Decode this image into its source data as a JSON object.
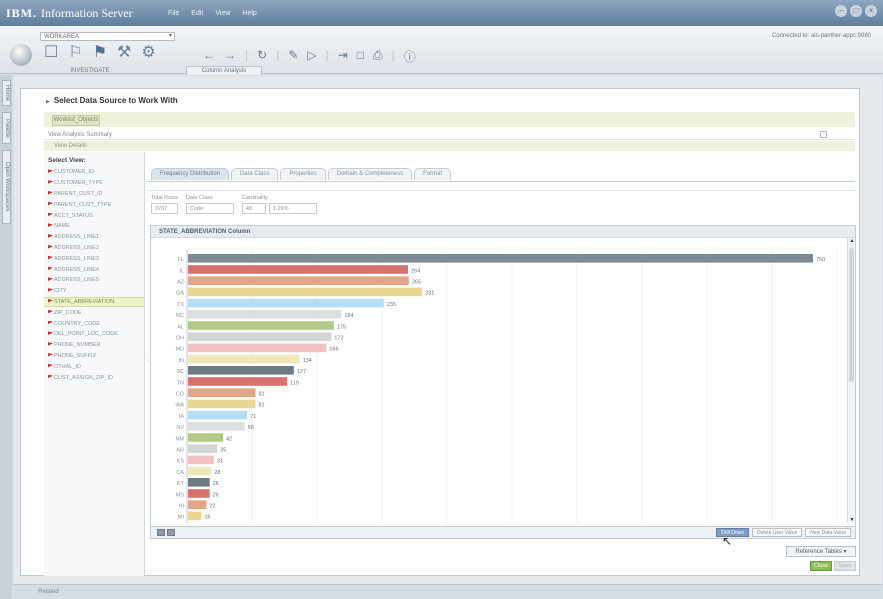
{
  "app": {
    "brand": "IBM.",
    "title": "Information Server",
    "menus": [
      "File",
      "Edit",
      "View",
      "Help"
    ],
    "window_buttons": [
      "–",
      "□",
      "×"
    ]
  },
  "toolbar": {
    "workspace_select": "WORKAREA",
    "pillar_label": "INVESTIGATE",
    "icons": [
      "home-pillar",
      "overview-pillar",
      "investigate-pillar",
      "develop-pillar",
      "operate-pillar"
    ],
    "tools": [
      "back-arrow",
      "forward-arrow",
      "refresh",
      "edit",
      "run",
      "publish",
      "help"
    ],
    "open_tab": "Column Analysis",
    "connection_status": "Connected to: ais-panther-appc:9080"
  },
  "side_tabs": [
    "Home",
    "Palette",
    "Open Workspaces"
  ],
  "header": {
    "select_source": "Select Data Source to Work With"
  },
  "workspace_tab": "Worklist_Objects",
  "rows": {
    "summary": "View Analysis Summary",
    "details": "View Details"
  },
  "views": {
    "title": "Select View:",
    "items": [
      "CUSTOMER_ID",
      "CUSTOMER_TYPE",
      "PARENT_CUST_ID",
      "PARENT_CUST_TYPE",
      "ACCT_STATUS",
      "NAME",
      "ADDRESS_LINE1",
      "ADDRESS_LINE2",
      "ADDRESS_LINE3",
      "ADDRESS_LINE4",
      "ADDRESS_LINE5",
      "CITY",
      "STATE_ABBREVIATION",
      "ZIP_CODE",
      "COUNTRY_CODE",
      "DEL_POINT_LOC_CODE",
      "PHONE_NUMBER",
      "PHONE_SUFFIX",
      "OTHAL_ID",
      "CUST_ASSIGN_ZIP_ID"
    ],
    "selected": "STATE_ABBREVIATION"
  },
  "tabs": [
    "Frequency Distribution",
    "Data Class",
    "Properties",
    "Domain & Completeness",
    "Format"
  ],
  "active_tab": "Frequency Distribution",
  "stats": {
    "total_rows_label": "Total Rows",
    "total_rows": "3707",
    "data_class_label": "Data Class",
    "data_class": "Code",
    "cardinality_label": "Cardinality",
    "cardinality_count": "48",
    "cardinality_pct": "1.29%"
  },
  "chart_header": "STATE_ABBREVIATION Column",
  "chart_data": {
    "type": "bar",
    "orientation": "horizontal",
    "categories": [
      "FL",
      "IL",
      "AZ",
      "GA",
      "TX",
      "NC",
      "AL",
      "OH",
      "MD",
      "IN",
      "SC",
      "TN",
      "CO",
      "WA",
      "IA",
      "NV",
      "NM",
      "AR",
      "KS",
      "CA",
      "KY",
      "MS",
      "HI",
      "MI"
    ],
    "values": [
      750,
      264,
      265,
      281,
      235,
      184,
      175,
      172,
      166,
      134,
      127,
      119,
      81,
      81,
      71,
      68,
      42,
      35,
      31,
      28,
      26,
      26,
      22,
      16
    ],
    "xlim": [
      0,
      780
    ],
    "grid": true,
    "colors": [
      "#7e8b93",
      "#d8726f",
      "#e3a586",
      "#e9d692",
      "#b6def0",
      "#dedede",
      "#b3c98a",
      "#d4d4d4",
      "#efc1c1",
      "#eee9b6",
      "#707a85",
      "#d8726f",
      "#e3a586",
      "#e9d692",
      "#b6def0",
      "#dedede",
      "#b3c98a",
      "#d4d4d4",
      "#efc1c1",
      "#eee9b6",
      "#707a85",
      "#d8726f",
      "#e3a586",
      "#e9d692"
    ]
  },
  "bottom_buttons": {
    "drill_down": "Drill Down",
    "delete_user_value": "Delete User Value",
    "new_data_value": "New Data Value"
  },
  "reference_tables": "Reference Tables ▾",
  "actions": {
    "close": "Close",
    "save": "Save"
  },
  "related": "Related"
}
